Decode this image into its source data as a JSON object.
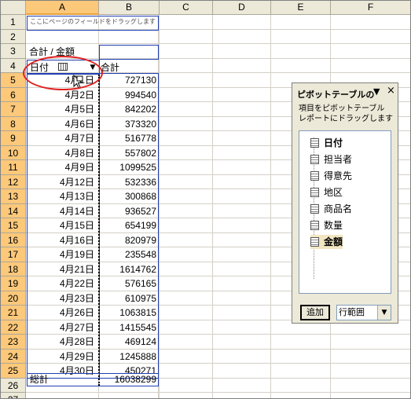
{
  "columns": [
    "A",
    "B",
    "C",
    "D",
    "E",
    "F"
  ],
  "rows": [
    "1",
    "2",
    "3",
    "4",
    "5",
    "6",
    "7",
    "8",
    "9",
    "10",
    "11",
    "12",
    "13",
    "14",
    "15",
    "16",
    "17",
    "18",
    "19",
    "20",
    "21",
    "22",
    "23",
    "24",
    "25",
    "26",
    "27"
  ],
  "pivot": {
    "page_field_hint": "ここにページのフィールドをドラッグします",
    "data_label": "合計 / 金額",
    "row_field": "日付",
    "col_header": "合計",
    "items": [
      {
        "date": "4月1日",
        "value": "727130"
      },
      {
        "date": "4月2日",
        "value": "994540"
      },
      {
        "date": "4月5日",
        "value": "842202"
      },
      {
        "date": "4月6日",
        "value": "373320"
      },
      {
        "date": "4月7日",
        "value": "516778"
      },
      {
        "date": "4月8日",
        "value": "557802"
      },
      {
        "date": "4月9日",
        "value": "1099525"
      },
      {
        "date": "4月12日",
        "value": "532336"
      },
      {
        "date": "4月13日",
        "value": "300868"
      },
      {
        "date": "4月14日",
        "value": "936527"
      },
      {
        "date": "4月15日",
        "value": "654199"
      },
      {
        "date": "4月16日",
        "value": "820979"
      },
      {
        "date": "4月19日",
        "value": "235548"
      },
      {
        "date": "4月21日",
        "value": "1614762"
      },
      {
        "date": "4月22日",
        "value": "576165"
      },
      {
        "date": "4月23日",
        "value": "610975"
      },
      {
        "date": "4月26日",
        "value": "1063815"
      },
      {
        "date": "4月27日",
        "value": "1415545"
      },
      {
        "date": "4月28日",
        "value": "469124"
      },
      {
        "date": "4月29日",
        "value": "1245888"
      },
      {
        "date": "4月30日",
        "value": "450271"
      }
    ],
    "total_label": "総計",
    "total_value": "16038299"
  },
  "pane": {
    "title": "ピボットテーブルの",
    "menu_glyph": "▼",
    "close_glyph": "×",
    "description": "項目をピボットテーブル\nレポートにドラッグします",
    "fields": [
      {
        "label": "日付",
        "bold": true
      },
      {
        "label": "担当者",
        "bold": false
      },
      {
        "label": "得意先",
        "bold": false
      },
      {
        "label": "地区",
        "bold": false
      },
      {
        "label": "商品名",
        "bold": false
      },
      {
        "label": "数量",
        "bold": false
      },
      {
        "label": "金額",
        "bold": true
      }
    ],
    "add_button": "追加",
    "area_select": "行範囲"
  }
}
